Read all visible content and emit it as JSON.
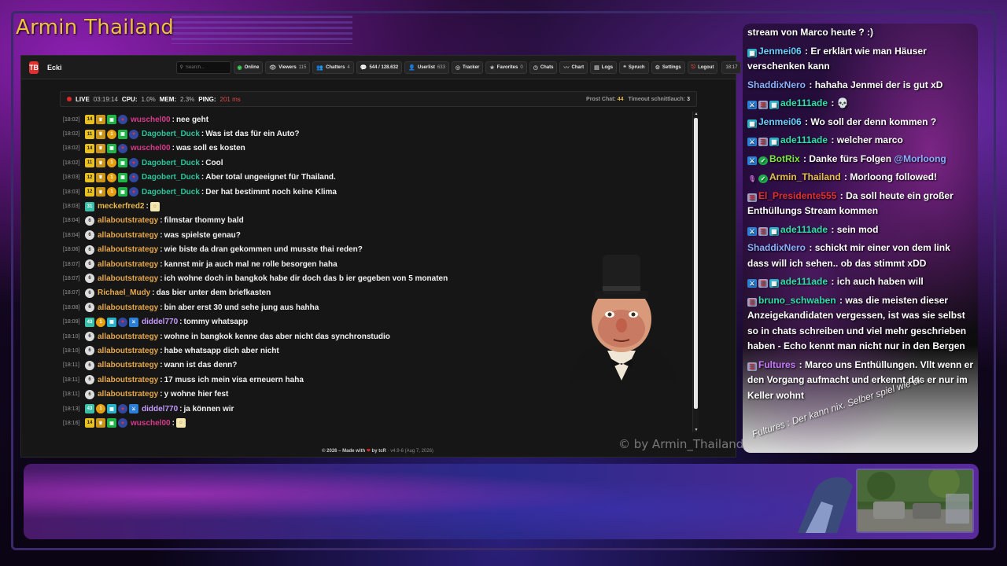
{
  "overlay": {
    "channel_title": "Armin Thailand",
    "watermark": "© by Armin_Thailand"
  },
  "toolbar": {
    "logo": "TB",
    "app_name": "Ecki",
    "search_placeholder": "Search...",
    "buttons": [
      {
        "icon": "online-icon",
        "label": "Online",
        "count": ""
      },
      {
        "icon": "eye-icon",
        "label": "Viewers",
        "count": "115"
      },
      {
        "icon": "users-icon",
        "label": "Chatters",
        "count": "4"
      },
      {
        "icon": "chat-icon",
        "label": "544 / 128.632",
        "count": ""
      },
      {
        "icon": "user-icon",
        "label": "Userlist",
        "count": "633"
      },
      {
        "icon": "tracker-icon",
        "label": "Tracker",
        "count": ""
      },
      {
        "icon": "star-icon",
        "label": "Favorites",
        "count": "0"
      },
      {
        "icon": "clock-icon",
        "label": "Chats",
        "count": ""
      },
      {
        "icon": "chart-icon",
        "label": "Chart",
        "count": ""
      },
      {
        "icon": "logs-icon",
        "label": "Logs",
        "count": ""
      },
      {
        "icon": "speech-icon",
        "label": "Spruch",
        "count": ""
      },
      {
        "icon": "gear-icon",
        "label": "Settings",
        "count": ""
      },
      {
        "icon": "logout-icon",
        "label": "Logout",
        "count": ""
      }
    ],
    "clock": "18:17"
  },
  "status": {
    "live_label": "LIVE",
    "uptime": "03:19:14",
    "cpu_label": "CPU:",
    "cpu": "1.0%",
    "mem_label": "MEM:",
    "mem": "2.3%",
    "ping_label": "PING:",
    "ping": "201 ms",
    "prost_label": "Prost Chat:",
    "prost_value": "44",
    "timeout_label": "Timeout schnittlauch:",
    "timeout_value": "3"
  },
  "chat": [
    {
      "ts": "[18:02]",
      "badges": [
        "14",
        "crown",
        "gift",
        "flag"
      ],
      "user": "wuschel00",
      "color": "#d83a8a",
      "msg": "nee geht"
    },
    {
      "ts": "[18:02]",
      "badges": [
        "11",
        "crown",
        "coin",
        "gift",
        "flag"
      ],
      "user": "Dagobert_Duck",
      "color": "#29c49a",
      "msg": "Was ist das für ein Auto?"
    },
    {
      "ts": "[18:02]",
      "badges": [
        "14",
        "crown",
        "gift",
        "flag"
      ],
      "user": "wuschel00",
      "color": "#d83a8a",
      "msg": "was soll es kosten"
    },
    {
      "ts": "[18:02]",
      "badges": [
        "11",
        "crown",
        "coin",
        "gift",
        "flag"
      ],
      "user": "Dagobert_Duck",
      "color": "#29c49a",
      "msg": "Cool"
    },
    {
      "ts": "[18:03]",
      "badges": [
        "12",
        "crown",
        "coin",
        "gift",
        "flag"
      ],
      "user": "Dagobert_Duck",
      "color": "#29c49a",
      "msg": "Aber total ungeeignet für Thailand."
    },
    {
      "ts": "[18:03]",
      "badges": [
        "12",
        "crown",
        "coin",
        "gift",
        "flag"
      ],
      "user": "Dagobert_Duck",
      "color": "#29c49a",
      "msg": "Der hat bestimmt noch keine Klima"
    },
    {
      "ts": "[18:03]",
      "badges": [
        "31"
      ],
      "user": "meckerfred2",
      "color": "#e8b84a",
      "msg": ""
    },
    {
      "ts": "[18:04]",
      "badges": [
        "6"
      ],
      "user": "allaboutstrategy",
      "color": "#e6a84a",
      "msg": "filmstar thommy bald"
    },
    {
      "ts": "[18:04]",
      "badges": [
        "6"
      ],
      "user": "allaboutstrategy",
      "color": "#e6a84a",
      "msg": "was spielste genau?"
    },
    {
      "ts": "[18:06]",
      "badges": [
        "6"
      ],
      "user": "allaboutstrategy",
      "color": "#e6a84a",
      "msg": "wie biste da dran gekommen und musste thai reden?"
    },
    {
      "ts": "[18:07]",
      "badges": [
        "6"
      ],
      "user": "allaboutstrategy",
      "color": "#e6a84a",
      "msg": "kannst mir ja auch mal ne rolle besorgen haha"
    },
    {
      "ts": "[18:07]",
      "badges": [
        "6"
      ],
      "user": "allaboutstrategy",
      "color": "#e6a84a",
      "msg": "ich wohne doch in bangkok habe dir doch das b ier gegeben von 5 monaten"
    },
    {
      "ts": "[18:07]",
      "badges": [
        "6"
      ],
      "user": "Richael_Mudy",
      "color": "#e6a84a",
      "msg": "das bier unter dem briefkasten"
    },
    {
      "ts": "[18:08]",
      "badges": [
        "6"
      ],
      "user": "allaboutstrategy",
      "color": "#e6a84a",
      "msg": "bin aber erst 30 und sehe jung aus hahha"
    },
    {
      "ts": "[18:09]",
      "badges": [
        "43",
        "coin",
        "dev",
        "flag",
        "mod"
      ],
      "user": "diddel770",
      "color": "#c49aff",
      "msg": "tommy whatsapp"
    },
    {
      "ts": "[18:10]",
      "badges": [
        "6"
      ],
      "user": "allaboutstrategy",
      "color": "#e6a84a",
      "msg": "wohne in bangkok kenne das aber nicht das synchronstudio"
    },
    {
      "ts": "[18:10]",
      "badges": [
        "6"
      ],
      "user": "allaboutstrategy",
      "color": "#e6a84a",
      "msg": "habe whatsapp dich aber nicht"
    },
    {
      "ts": "[18:11]",
      "badges": [
        "6"
      ],
      "user": "allaboutstrategy",
      "color": "#e6a84a",
      "msg": "wann ist das denn?"
    },
    {
      "ts": "[18:11]",
      "badges": [
        "6"
      ],
      "user": "allaboutstrategy",
      "color": "#e6a84a",
      "msg": "17 muss ich mein visa erneuern haha"
    },
    {
      "ts": "[18:11]",
      "badges": [
        "6"
      ],
      "user": "allaboutstrategy",
      "color": "#e6a84a",
      "msg": "y wohne hier fest"
    },
    {
      "ts": "[18:13]",
      "badges": [
        "43",
        "coin",
        "dev",
        "flag",
        "mod"
      ],
      "user": "diddel770",
      "color": "#c49aff",
      "msg": "ja können wir"
    },
    {
      "ts": "[18:16]",
      "badges": [
        "14",
        "crown",
        "gift",
        "flag"
      ],
      "user": "wuschel00",
      "color": "#d83a8a",
      "msg": ""
    }
  ],
  "footer": {
    "copyright": "© 2026 – Made with",
    "by": "by tcR",
    "version": "· v4.9-6 (Aug 7, 2026)"
  },
  "side_chat": [
    {
      "icons": [],
      "user": "",
      "color": "#fff",
      "msg": "stream von Marco heute ? :)"
    },
    {
      "icons": [
        "dev"
      ],
      "user": "Jenmei06",
      "color": "#6ad0ff",
      "msg": "Er erklärt wie man Häuser verschenken kann"
    },
    {
      "icons": [],
      "user": "ShaddixNero",
      "color": "#8ab0ff",
      "msg": "hahaha Jenmei der is gut xD"
    },
    {
      "icons": [
        "mod",
        "flag",
        "dev"
      ],
      "user": "ade111ade",
      "color": "#2fe0a8",
      "msg": "💀"
    },
    {
      "icons": [
        "dev"
      ],
      "user": "Jenmei06",
      "color": "#6ad0ff",
      "msg": "Wo soll der denn kommen ?"
    },
    {
      "icons": [
        "mod",
        "flag",
        "dev"
      ],
      "user": "ade111ade",
      "color": "#2fe0a8",
      "msg": "welcher marco"
    },
    {
      "icons": [
        "mod",
        "check"
      ],
      "user": "BotRix",
      "color": "#7ae83a",
      "msg": "Danke fürs Folgen",
      "mention": "@Morloong"
    },
    {
      "icons": [
        "mic",
        "check"
      ],
      "user": "Armin_Thailand",
      "color": "#e6c04a",
      "msg": "Morloong followed!"
    },
    {
      "icons": [
        "flag"
      ],
      "user": "El_Presidente555",
      "color": "#e03030",
      "msg": "Da soll heute ein großer Enthüllungs Stream kommen"
    },
    {
      "icons": [
        "mod",
        "flag",
        "dev"
      ],
      "user": "ade111ade",
      "color": "#2fe0a8",
      "msg": "sein mod"
    },
    {
      "icons": [],
      "user": "ShaddixNero",
      "color": "#8ab0ff",
      "msg": "schickt mir einer von dem link dass will ich sehen.. ob das stimmt xDD"
    },
    {
      "icons": [
        "mod",
        "flag",
        "dev"
      ],
      "user": "ade111ade",
      "color": "#2fe0a8",
      "msg": "ich auch haben will"
    },
    {
      "icons": [
        "flag"
      ],
      "user": "bruno_schwaben",
      "color": "#2fe0a8",
      "msg": "was die meisten dieser Anzeigekandidaten vergessen, ist was sie selbst so in chats schreiben und viel mehr geschrieben haben - Echo kennt man nicht nur in den Bergen"
    },
    {
      "icons": [
        "flag"
      ],
      "user": "Fultures",
      "color": "#c87aff",
      "msg": "Marco uns Enthüllungen. Vllt wenn er den Vorgang aufmacht und erkennt das er nur im Keller wohnt"
    }
  ],
  "side_chat_tilted": "Fultures : Der kann nix. Selber spiel wie ck"
}
